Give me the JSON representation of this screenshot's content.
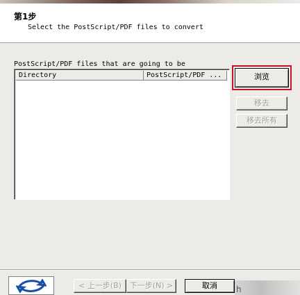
{
  "header": {
    "step_title": "第1步",
    "step_description": "Select the PostScript/PDF files to convert"
  },
  "file_list": {
    "caption": "PostScript/PDF files that are going to be",
    "columns": [
      {
        "label": "Directory"
      },
      {
        "label": "PostScript/PDF ..."
      }
    ],
    "rows": []
  },
  "side_buttons": {
    "browse_label": "浏览",
    "remove_label": "移去",
    "remove_all_label": "移去所有"
  },
  "footer": {
    "back_label": "< 上一步(B)",
    "next_label": "下一步(N) >",
    "cancel_label": "取消",
    "watermark_text": "h"
  },
  "colors": {
    "highlight": "#c8102e",
    "dialog_bg": "#ecebe6"
  },
  "icons": {
    "logo": "swirl-logo-icon"
  }
}
